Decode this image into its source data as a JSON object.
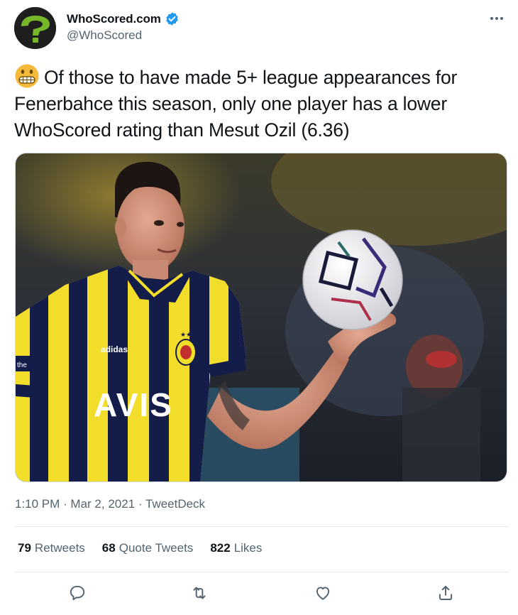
{
  "account": {
    "display_name": "WhoScored.com",
    "handle": "@WhoScored",
    "verified": true,
    "avatar_icon": "whoscored-question-logo",
    "avatar_accent": "#76b82a"
  },
  "tweet": {
    "emoji": "grimacing-face-emoji",
    "text": "Of those to have made 5+ league appearances for Fenerbahce this season, only one player has a lower WhoScored rating than Mesut Ozil (6.36)",
    "image_text": {
      "sponsor": "AVIS",
      "sleeve_brand": "adidas",
      "sleeve_patch": "the"
    }
  },
  "meta": {
    "time": "1:10 PM",
    "separator": " · ",
    "date": "Mar 2, 2021",
    "source": "TweetDeck"
  },
  "stats": [
    {
      "count": "79",
      "label": "Retweets"
    },
    {
      "count": "68",
      "label": "Quote Tweets"
    },
    {
      "count": "822",
      "label": "Likes"
    }
  ],
  "actions": [
    "reply-icon",
    "retweet-icon",
    "like-icon",
    "share-icon"
  ],
  "colors": {
    "verified_blue": "#1d9bf0",
    "secondary_text": "#536471",
    "kit_yellow": "#f2dd2a",
    "kit_navy": "#141c4a"
  }
}
